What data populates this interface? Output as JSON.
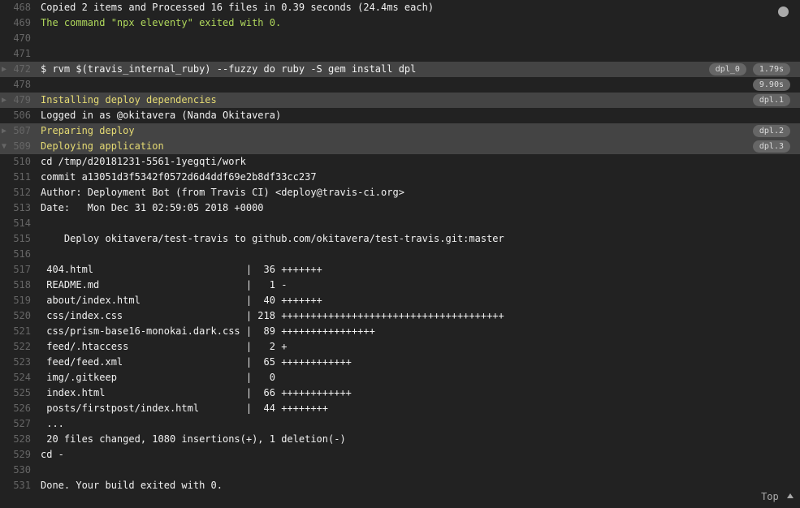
{
  "status_dot": true,
  "lines": [
    {
      "ln": 468,
      "text": "Copied 2 items and Processed 16 files in 0.39 seconds (24.4ms each)"
    },
    {
      "ln": 469,
      "text": "The command \"npx eleventy\" exited with 0.",
      "cls": "green"
    },
    {
      "ln": 470,
      "text": ""
    },
    {
      "ln": 471,
      "text": ""
    },
    {
      "ln": 472,
      "text": "$ rvm $(travis_internal_ruby) --fuzzy do ruby -S gem install dpl",
      "hl": true,
      "fold": "right",
      "badges": [
        "dpl_0",
        "1.79s"
      ]
    },
    {
      "ln": 478,
      "text": "",
      "badges": [
        "9.90s"
      ]
    },
    {
      "ln": 479,
      "text": "Installing deploy dependencies",
      "cls": "yellow",
      "hl": true,
      "fold": "right",
      "badges": [
        "dpl.1"
      ]
    },
    {
      "ln": 506,
      "text": "Logged in as @okitavera (Nanda Okitavera)"
    },
    {
      "ln": 507,
      "text": "Preparing deploy",
      "cls": "yellow",
      "hl": true,
      "fold": "right",
      "badges": [
        "dpl.2"
      ]
    },
    {
      "ln": 509,
      "text": "Deploying application",
      "cls": "yellow",
      "hl": true,
      "fold": "down",
      "badges": [
        "dpl.3"
      ]
    },
    {
      "ln": 510,
      "text": "cd /tmp/d20181231-5561-1yegqti/work"
    },
    {
      "ln": 511,
      "text": "commit a13051d3f5342f0572d6d4ddf69e2b8df33cc237"
    },
    {
      "ln": 512,
      "text": "Author: Deployment Bot (from Travis CI) <deploy@travis-ci.org>"
    },
    {
      "ln": 513,
      "text": "Date:   Mon Dec 31 02:59:05 2018 +0000"
    },
    {
      "ln": 514,
      "text": ""
    },
    {
      "ln": 515,
      "text": "    Deploy okitavera/test-travis to github.com/okitavera/test-travis.git:master"
    },
    {
      "ln": 516,
      "text": ""
    },
    {
      "ln": 517,
      "text": " 404.html                          |  36 +++++++"
    },
    {
      "ln": 518,
      "text": " README.md                         |   1 -"
    },
    {
      "ln": 519,
      "text": " about/index.html                  |  40 +++++++"
    },
    {
      "ln": 520,
      "text": " css/index.css                     | 218 ++++++++++++++++++++++++++++++++++++++"
    },
    {
      "ln": 521,
      "text": " css/prism-base16-monokai.dark.css |  89 ++++++++++++++++"
    },
    {
      "ln": 522,
      "text": " feed/.htaccess                    |   2 +"
    },
    {
      "ln": 523,
      "text": " feed/feed.xml                     |  65 ++++++++++++"
    },
    {
      "ln": 524,
      "text": " img/.gitkeep                      |   0"
    },
    {
      "ln": 525,
      "text": " index.html                        |  66 ++++++++++++"
    },
    {
      "ln": 526,
      "text": " posts/firstpost/index.html        |  44 ++++++++"
    },
    {
      "ln": 527,
      "text": " ..."
    },
    {
      "ln": 528,
      "text": " 20 files changed, 1080 insertions(+), 1 deletion(-)"
    },
    {
      "ln": 529,
      "text": "cd -"
    },
    {
      "ln": 530,
      "text": ""
    },
    {
      "ln": 531,
      "text": "Done. Your build exited with 0."
    }
  ],
  "top_button": "Top"
}
